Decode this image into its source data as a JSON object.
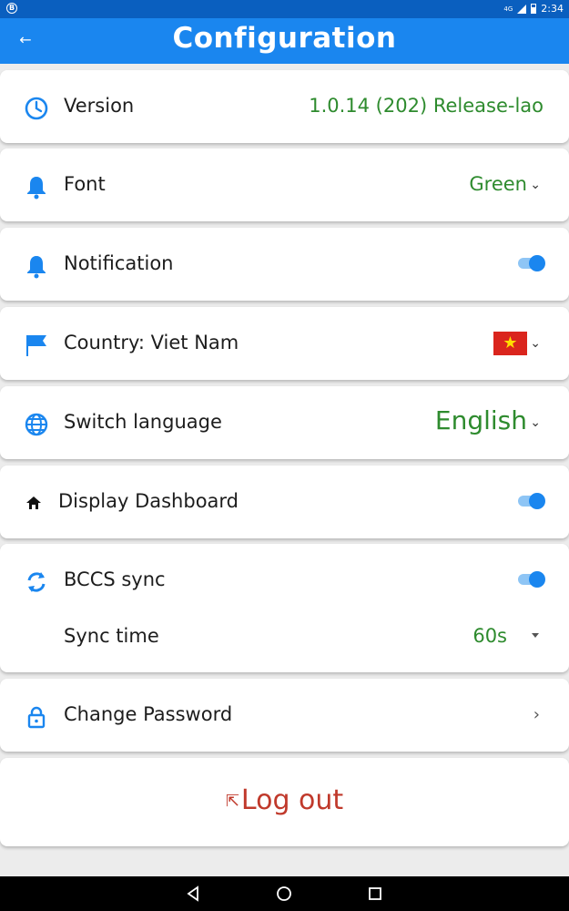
{
  "status_bar": {
    "time": "2:34",
    "network": "4G"
  },
  "app_bar": {
    "title": "Configuration",
    "back_icon": "arrow-back-icon"
  },
  "settings": {
    "version": {
      "label": "Version",
      "value": "1.0.14 (202) Release-lao",
      "icon": "clock-icon"
    },
    "font": {
      "label": "Font",
      "value": "Green",
      "icon": "bell-icon"
    },
    "notification": {
      "label": "Notification",
      "enabled": true,
      "icon": "bell-icon"
    },
    "country": {
      "label": "Country: Viet Nam",
      "flag": "vietnam-flag",
      "icon": "flag-icon"
    },
    "language": {
      "label": "Switch language",
      "value": "English",
      "icon": "globe-icon"
    },
    "dashboard": {
      "label": "Display Dashboard",
      "enabled": true,
      "icon": "home-icon"
    },
    "bccs_sync": {
      "label": "BCCS sync",
      "enabled": true,
      "icon": "sync-icon",
      "sync_time_label": "Sync time",
      "sync_time_value": "60s"
    },
    "password": {
      "label": "Change Password",
      "icon": "lock-icon"
    },
    "logout": {
      "label": "Log out",
      "icon": "logout-icon"
    }
  },
  "colors": {
    "accent": "#1a86ef",
    "value_green": "#2e8b2e",
    "logout_red": "#c0392b"
  }
}
